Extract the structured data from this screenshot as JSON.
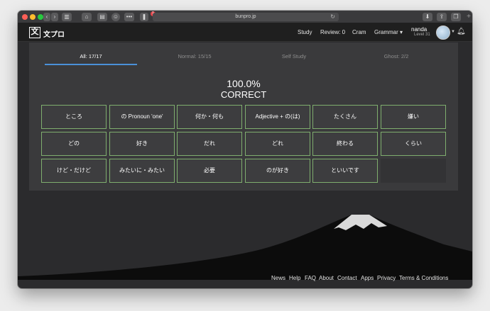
{
  "browser": {
    "url": "bunpro.jp",
    "notification_count": "1"
  },
  "site": {
    "logo_text": "文プロ",
    "logo_glyph": "文",
    "nav": [
      "Study",
      "Review: 0",
      "Cram",
      "Grammar ▾"
    ],
    "user": {
      "name": "nanda",
      "level": "Level 31"
    }
  },
  "tabs": [
    {
      "label": "All: 17/17",
      "active": true
    },
    {
      "label": "Normal: 15/15",
      "active": false
    },
    {
      "label": "Self Study",
      "active": false
    },
    {
      "label": "Ghost: 2/2",
      "active": false
    }
  ],
  "result": {
    "score": "100.0%",
    "status": "CORRECT"
  },
  "grammar_points": [
    "ところ",
    "の Pronoun 'one'",
    "何か・何も",
    "Adjective + の(は)",
    "たくさん",
    "嫌い",
    "どの",
    "好き",
    "だれ",
    "どれ",
    "終わる",
    "くらい",
    "けど・だけど",
    "みたいに・みたい",
    "必要",
    "のが好き",
    "といいです"
  ],
  "colors": {
    "correct_border": "#7fae6e",
    "active_tab_underline": "#4a90d9"
  },
  "footer": [
    "News",
    "Help",
    "FAQ",
    "About",
    "Contact",
    "Apps",
    "Privacy",
    "Terms & Conditions"
  ]
}
